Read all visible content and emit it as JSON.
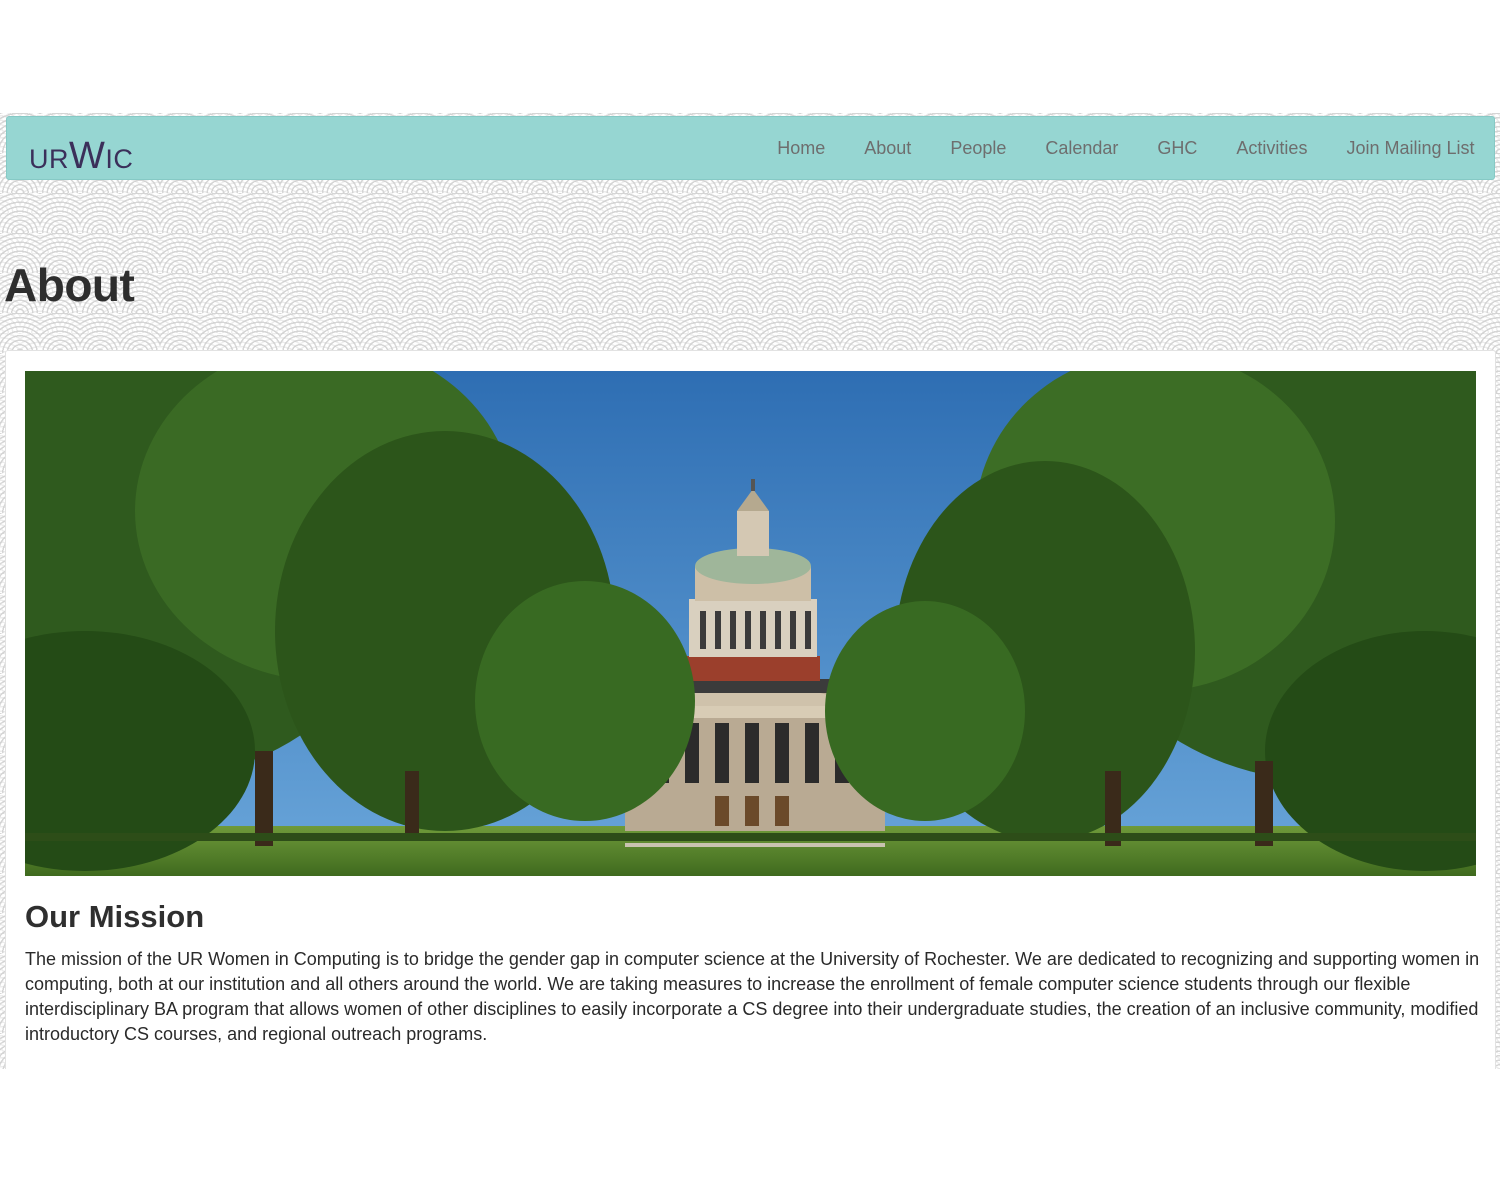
{
  "brand": {
    "logo_small_1": "UR",
    "logo_big": "W",
    "logo_small_2": "IC",
    "color": "#3b2f5a"
  },
  "navbar": {
    "background": "#96d6d2",
    "links": [
      "Home",
      "About",
      "People",
      "Calendar",
      "GHC",
      "Activities",
      "Join Mailing List"
    ]
  },
  "page": {
    "title": "About"
  },
  "hero_image": {
    "description_icon": "university-library-photo"
  },
  "mission": {
    "heading": "Our Mission",
    "body": "The mission of the UR Women in Computing is to bridge the gender gap in computer science at the University of Rochester. We are dedicated to recognizing and supporting women in computing, both at our institution and all others around the world. We are taking measures to increase the enrollment of female computer science students through our flexible interdisciplinary BA program that allows women of other disciplines to easily incorporate a CS degree into their undergraduate studies, the creation of an inclusive community, modified introductory CS courses, and regional outreach programs."
  }
}
